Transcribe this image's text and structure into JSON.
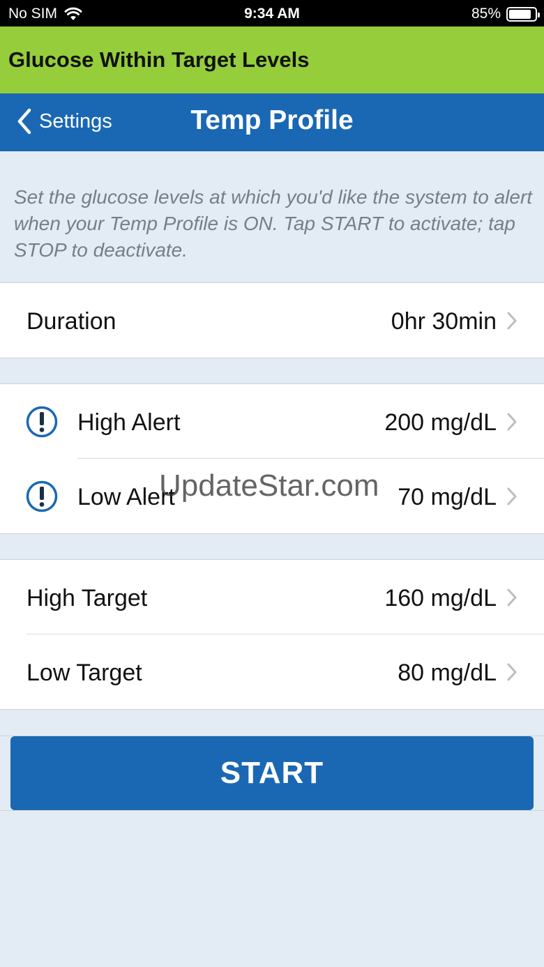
{
  "status_bar": {
    "carrier": "No SIM",
    "time": "9:34 AM",
    "battery_percent": "85%",
    "battery_level": 0.85
  },
  "alert_banner": {
    "text": "Glucose Within Target Levels",
    "color": "#95ce3a"
  },
  "nav": {
    "back_label": "Settings",
    "title": "Temp Profile",
    "color": "#1a68b3"
  },
  "description": "Set the glucose levels at which you'd like the system to alert when your Temp Profile is ON. Tap START to activate; tap STOP to deactivate.",
  "duration": {
    "label": "Duration",
    "value": "0hr 30min"
  },
  "alerts": [
    {
      "label": "High Alert",
      "value": "200 mg/dL",
      "icon": "exclamation-circle-icon"
    },
    {
      "label": "Low Alert",
      "value": "70 mg/dL",
      "icon": "exclamation-circle-icon"
    }
  ],
  "targets": [
    {
      "label": "High Target",
      "value": "160 mg/dL"
    },
    {
      "label": "Low Target",
      "value": "80 mg/dL"
    }
  ],
  "start_button": {
    "label": "START"
  },
  "watermark": "UpdateStar.com"
}
